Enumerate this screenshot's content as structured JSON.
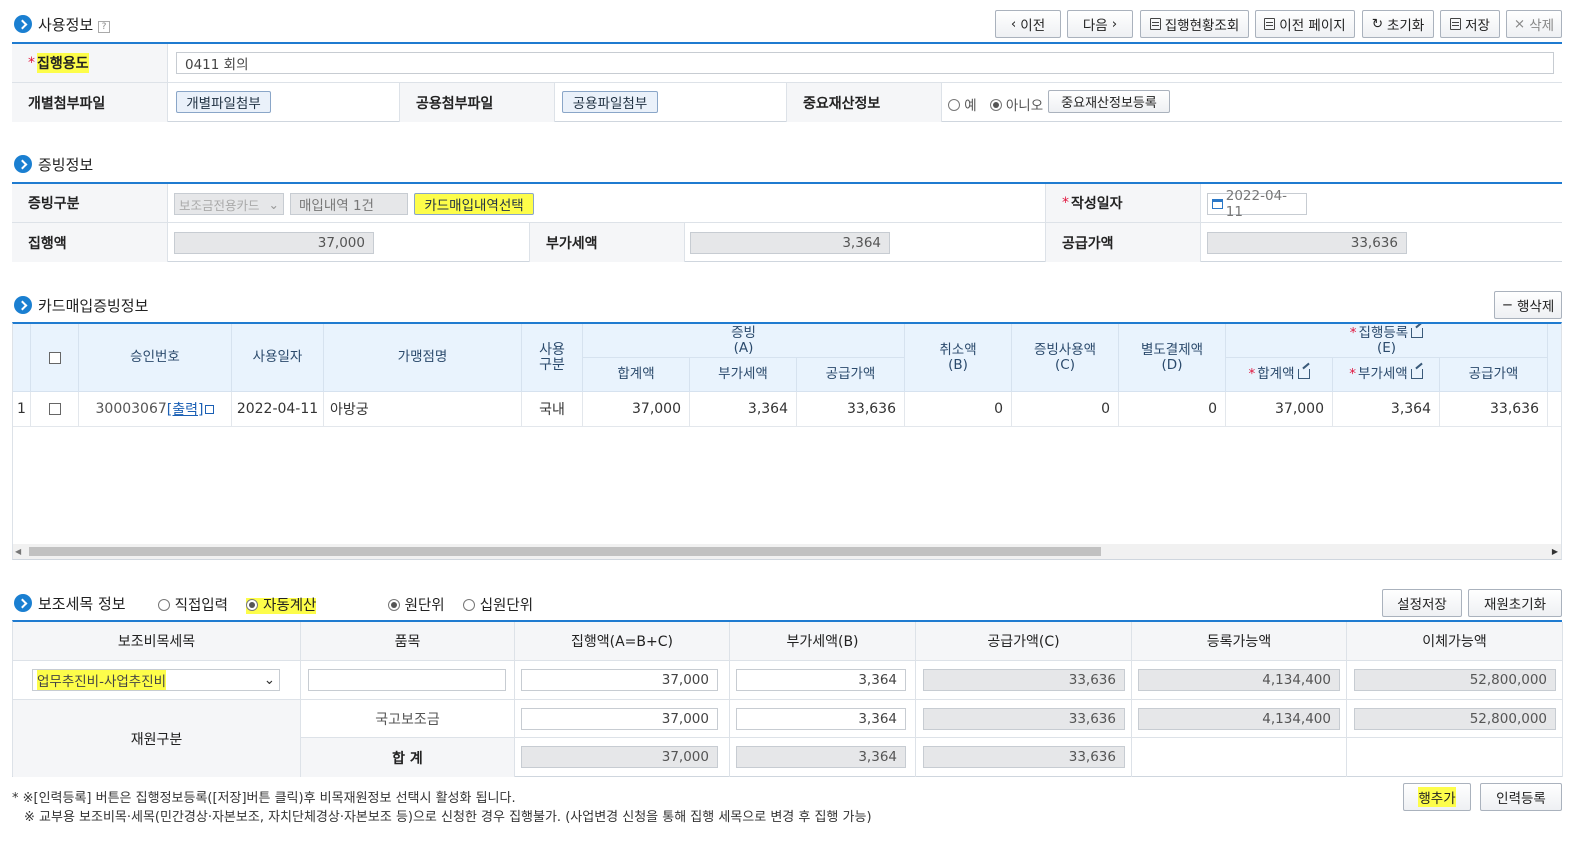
{
  "usage_section": {
    "title": "사용정보",
    "help_mark": "?",
    "toolbar": {
      "prev": "이전",
      "next": "다음",
      "status": "집행현황조회",
      "prev_page": "이전 페이지",
      "reset": "초기화",
      "save": "저장",
      "delete": "삭제"
    },
    "purpose_label": "집행용도",
    "purpose_value": "0411 회의",
    "individual_label": "개별첨부파일",
    "individual_btn": "개별파일첨부",
    "common_label": "공용첨부파일",
    "common_btn": "공용파일첨부",
    "asset_label": "중요재산정보",
    "asset_yes": "예",
    "asset_no": "아니오",
    "asset_btn": "중요재산정보등록"
  },
  "evidence_section": {
    "title": "증빙정보",
    "type_label": "증빙구분",
    "type_select": "보조금전용카드",
    "purchase_count": "매입내역 1건",
    "select_btn": "카드매입내역선택",
    "date_label": "작성일자",
    "date_value": "2022-04-11",
    "amount_label": "집행액",
    "amount_value": "37,000",
    "vat_label": "부가세액",
    "vat_value": "3,364",
    "supply_label": "공급가액",
    "supply_value": "33,636"
  },
  "card_section": {
    "title": "카드매입증빙정보",
    "delete_row_btn": "행삭제",
    "headers": {
      "approval": "승인번호",
      "use_date": "사용일자",
      "merchant": "가맹점명",
      "use_type_1": "사용",
      "use_type_2": "구분",
      "evidence_1": "증빙",
      "evidence_2": "(A)",
      "total": "합계액",
      "vat": "부가세액",
      "supply": "공급가액",
      "cancel_1": "취소액",
      "cancel_2": "(B)",
      "used_1": "증빙사용액",
      "used_2": "(C)",
      "separate_1": "별도결제액",
      "separate_2": "(D)",
      "exec_1": "집행등록",
      "exec_2": "(E)",
      "exec_total": "합계액",
      "exec_vat": "부가세액",
      "exec_supply": "공급가액"
    },
    "rows": [
      {
        "no": "1",
        "approval": "30003067",
        "print_link": "[출력]",
        "use_date": "2022-04-11",
        "merchant": "아방궁",
        "use_type": "국내",
        "total": "37,000",
        "vat": "3,364",
        "supply": "33,636",
        "cancel": "0",
        "used": "0",
        "separate": "0",
        "exec_total": "37,000",
        "exec_vat": "3,364",
        "exec_supply": "33,636"
      }
    ]
  },
  "sub_section": {
    "title": "보조세목 정보",
    "opt_direct": "직접입력",
    "opt_auto": "자동계산",
    "opt_won": "원단위",
    "opt_ten": "십원단위",
    "save_setting_btn": "설정저장",
    "reset_source_btn": "재원초기화",
    "headers": {
      "item": "보조비목세목",
      "product": "품목",
      "exec": "집행액(A=B+C)",
      "vat": "부가세액(B)",
      "supply": "공급가액(C)",
      "registrable": "등록가능액",
      "transferable": "이체가능액"
    },
    "row1": {
      "item_select": "업무추진비-사업추진비",
      "product": "",
      "exec": "37,000",
      "vat": "3,364",
      "supply": "33,636",
      "registrable": "4,134,400",
      "transferable": "52,800,000"
    },
    "source_label": "재원구분",
    "row2": {
      "name": "국고보조금",
      "exec": "37,000",
      "vat": "3,364",
      "supply": "33,636",
      "registrable": "4,134,400",
      "transferable": "52,800,000"
    },
    "total_row": {
      "label": "합 계",
      "exec": "37,000",
      "vat": "3,364",
      "supply": "33,636"
    }
  },
  "notes": {
    "line1": "* ※[인력등록] 버튼은 집행정보등록([저장]버튼 클릭)후 비목재원정보 선택시 활성화 됩니다.",
    "line2": "※ 교부용 보조비목·세목(민간경상·자본보조, 자치단체경상·자본보조 등)으로 신청한 경우 집행불가. (사업변경 신청을 통해 집행 세목으로 변경 후 집행 가능)"
  },
  "bottom_buttons": {
    "add_row": "행추가",
    "staff_register": "인력등록"
  },
  "colors": {
    "accent_blue": "#1f7bd0",
    "highlight": "#fdfd4a",
    "required": "#e0143c"
  }
}
